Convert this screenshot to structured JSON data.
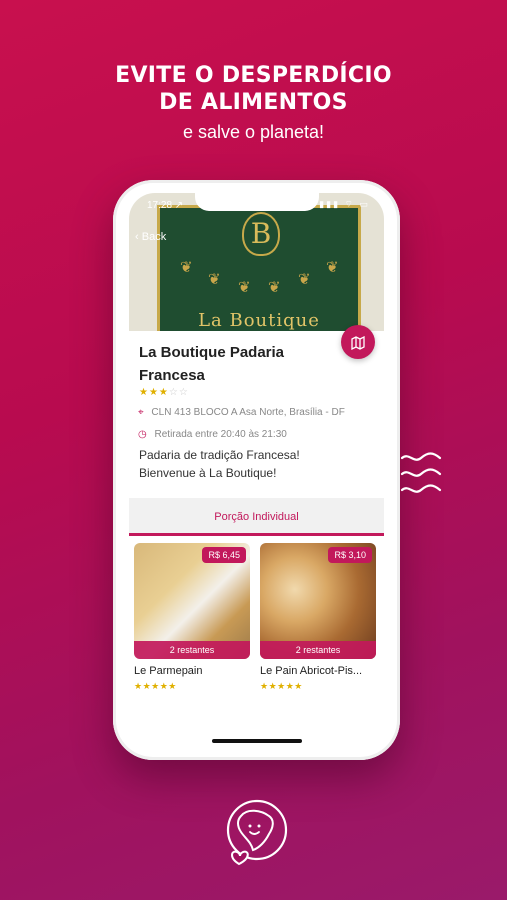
{
  "headline": {
    "line1": "EVITE O DESPERDÍCIO",
    "line2": "DE ALIMENTOS",
    "line3": "e salve o planeta!"
  },
  "status_bar": {
    "time": "17:28 ↗",
    "icons": "▮▮▮ ⌔ ▭"
  },
  "nav": {
    "back_label": "Back"
  },
  "banner": {
    "emblem_letter": "B",
    "brand_text": "La Boutique"
  },
  "shop": {
    "name": "La Boutique Padaria Francesa",
    "rating_stars": 2.5,
    "rating_filled": "★★★",
    "rating_empty": "☆☆",
    "address": "CLN 413 BLOCO A Asa Norte, Brasília - DF",
    "pickup": "Retirada entre 20:40 às 21:30",
    "description_line1": "Padaria de tradição Francesa!",
    "description_line2": "Bienvenue à La Boutique!"
  },
  "tab": {
    "label": "Porção Individual"
  },
  "products": [
    {
      "name": "Le Parmepain",
      "price": "R$ 6,45",
      "remaining": "2 restantes",
      "stars": "★★★★★"
    },
    {
      "name": "Le Pain Abricot-Pis...",
      "price": "R$ 3,10",
      "remaining": "2 restantes",
      "stars": "★★★★★"
    }
  ],
  "icons": {
    "map": "map-icon",
    "pin": "location-pin-icon",
    "clock": "clock-icon",
    "back": "chevron-left-icon",
    "waves": "wave-lines-icon",
    "logo": "brazil-heart-logo-icon"
  },
  "colors": {
    "accent": "#c2185b",
    "background_top": "#c8104e",
    "background_bottom": "#9a1a6a",
    "star": "#e0b000"
  }
}
